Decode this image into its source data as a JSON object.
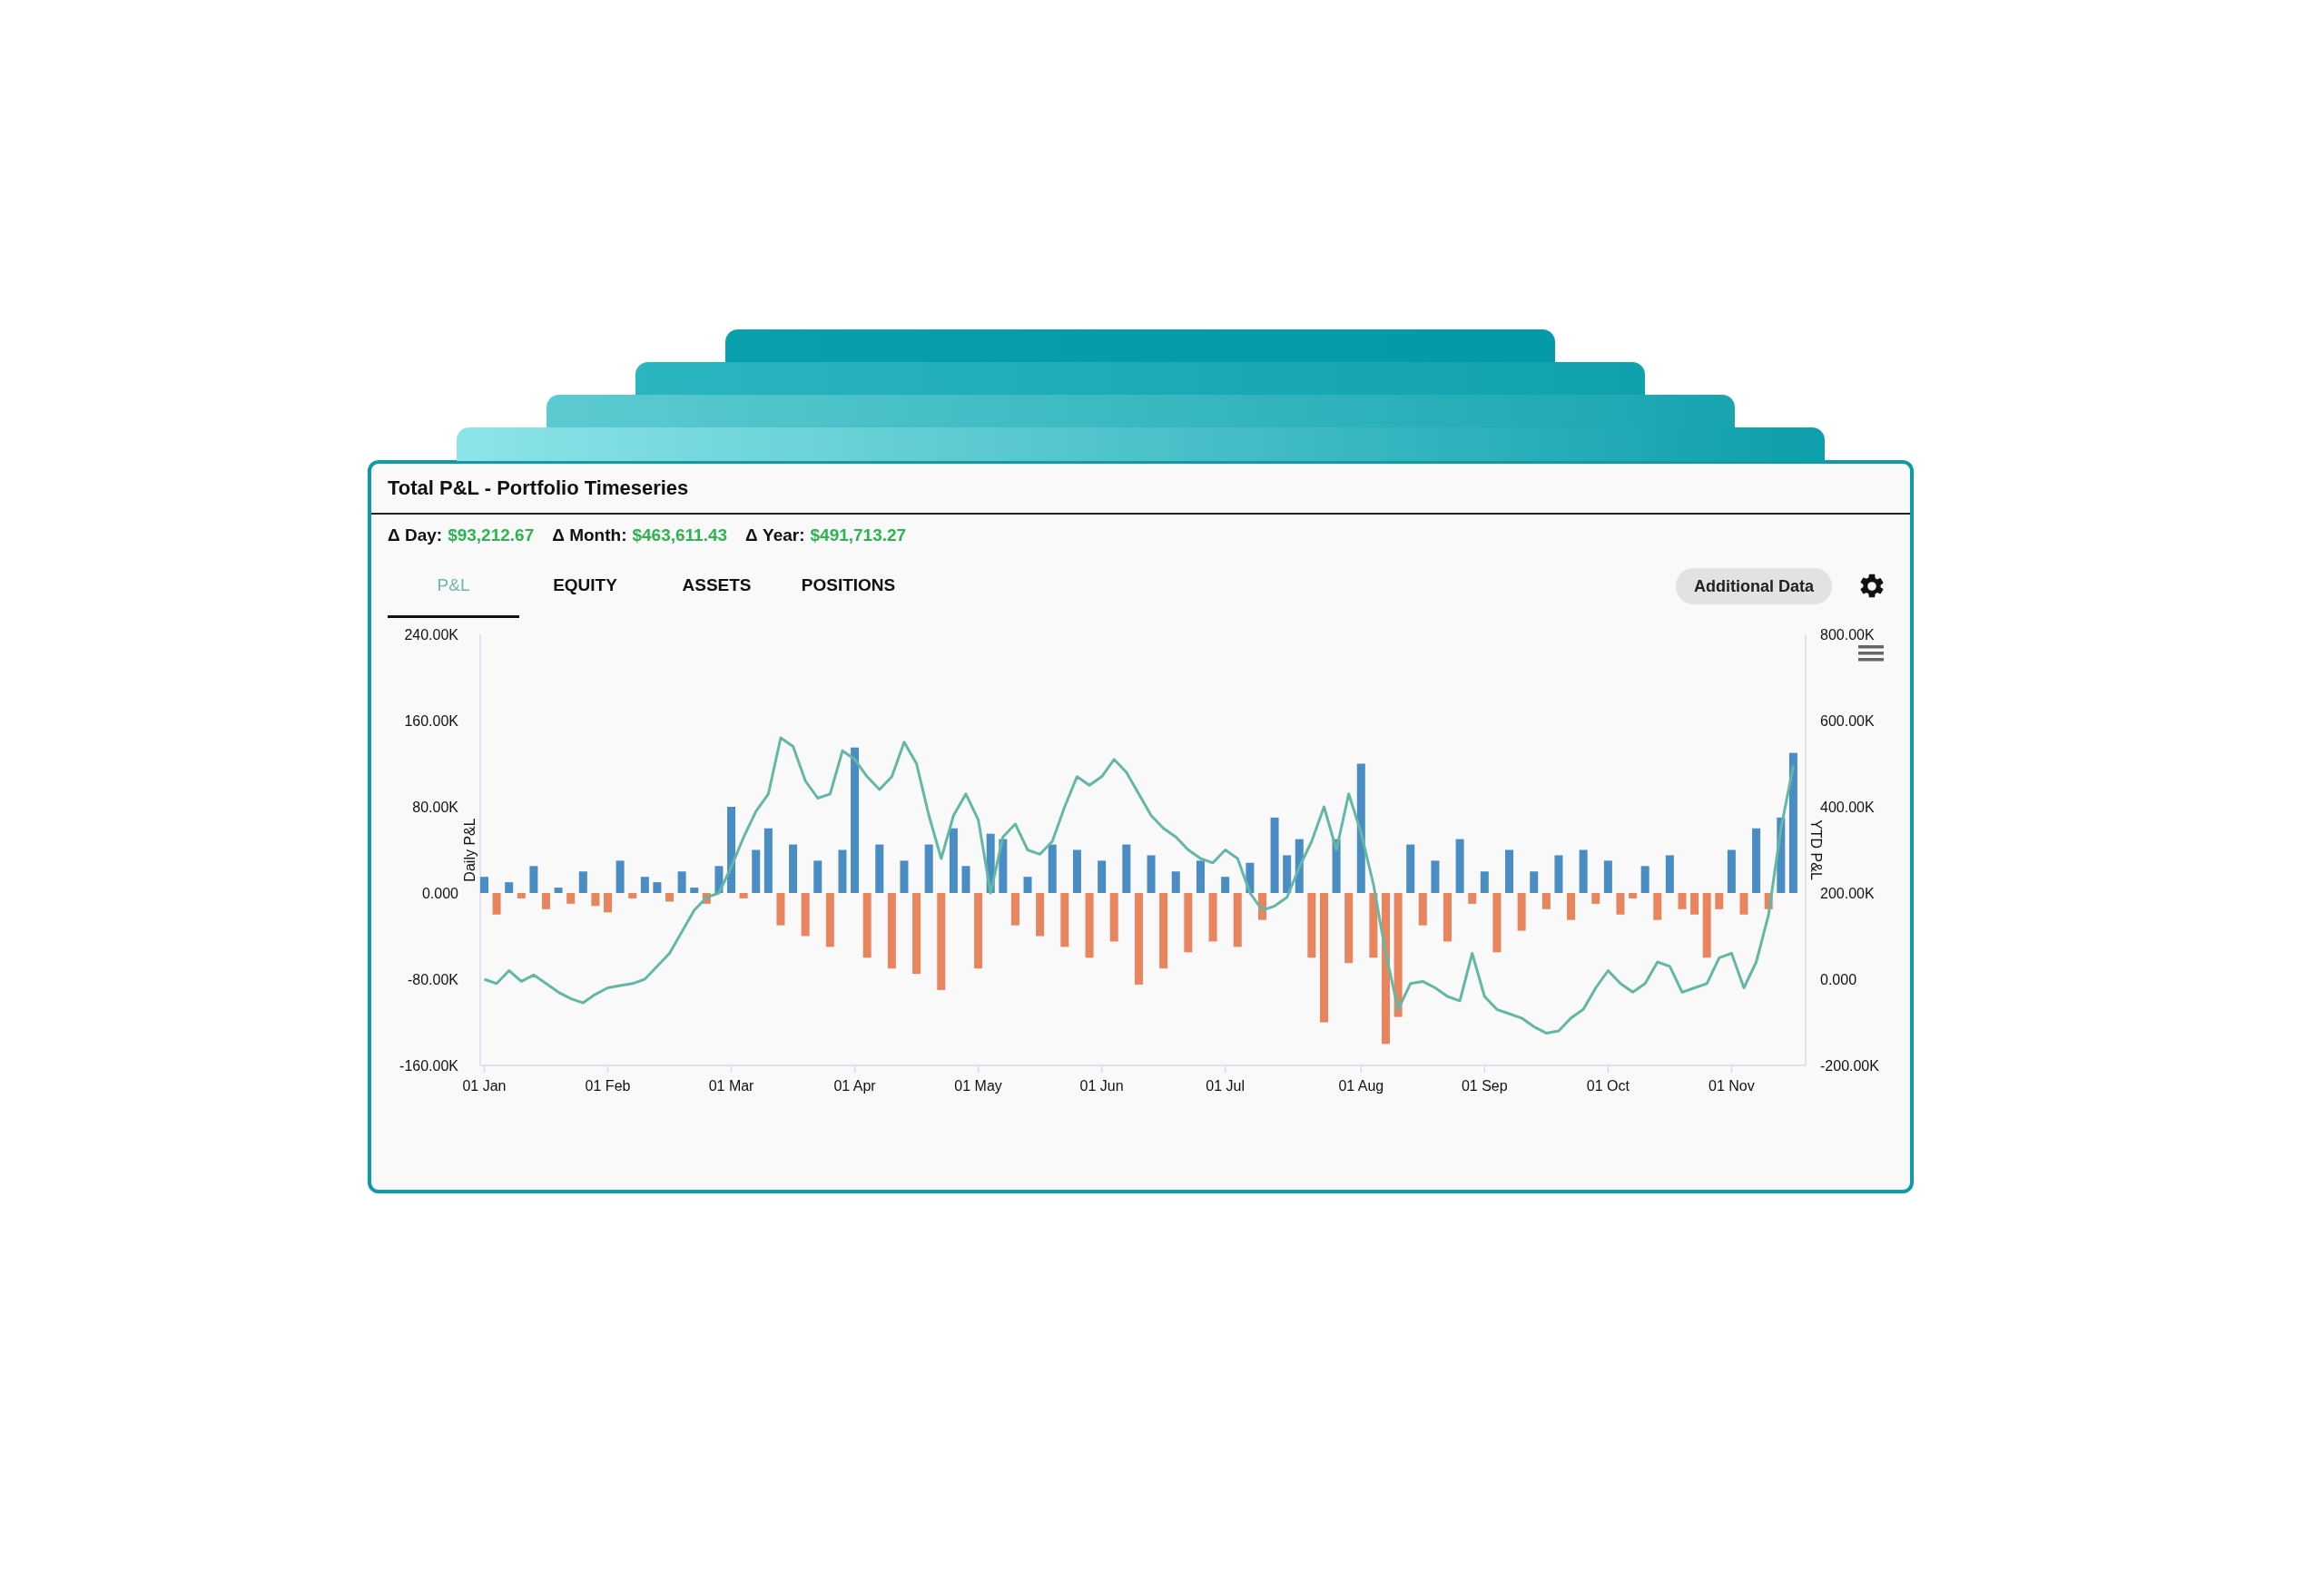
{
  "window": {
    "title": "Total P&L - Portfolio Timeseries"
  },
  "stats": [
    {
      "label": "Δ Day:",
      "value": "$93,212.67"
    },
    {
      "label": "Δ Month:",
      "value": "$463,611.43"
    },
    {
      "label": "Δ Year:",
      "value": "$491,713.27"
    }
  ],
  "tabs": [
    {
      "label": "P&L",
      "selected": true
    },
    {
      "label": "EQUITY",
      "selected": false
    },
    {
      "label": "ASSETS",
      "selected": false
    },
    {
      "label": "POSITIONS",
      "selected": false
    }
  ],
  "additional_button": {
    "label": "Additional Data"
  },
  "chart": {
    "chart_data": {
      "type": "bar",
      "ylabel": "Daily P&L",
      "y2label": "YTD P&L",
      "ylim": [
        -160,
        240
      ],
      "y2lim": [
        -200,
        800
      ],
      "categories": [
        "01 Jan",
        null,
        null,
        null,
        null,
        null,
        null,
        null,
        null,
        null,
        "01 Feb",
        null,
        null,
        null,
        null,
        null,
        null,
        null,
        null,
        null,
        "01 Mar",
        null,
        null,
        null,
        null,
        null,
        null,
        null,
        null,
        null,
        "01 Apr",
        null,
        null,
        null,
        null,
        null,
        null,
        null,
        null,
        null,
        "01 May",
        null,
        null,
        null,
        null,
        null,
        null,
        null,
        null,
        null,
        "01 Jun",
        null,
        null,
        null,
        null,
        null,
        null,
        null,
        null,
        null,
        "01 Jul",
        null,
        null,
        null,
        null,
        null,
        null,
        null,
        null,
        null,
        null,
        "01 Aug",
        null,
        null,
        null,
        null,
        null,
        null,
        null,
        null,
        null,
        "01 Sep",
        null,
        null,
        null,
        null,
        null,
        null,
        null,
        null,
        null,
        "01 Oct",
        null,
        null,
        null,
        null,
        null,
        null,
        null,
        null,
        null,
        "01 Nov",
        null,
        null,
        null,
        null,
        null
      ],
      "yticks": [
        {
          "value": 240,
          "label": "240.00K"
        },
        {
          "value": 160,
          "label": "160.00K"
        },
        {
          "value": 80,
          "label": "80.00K"
        },
        {
          "value": 0,
          "label": "0.000"
        },
        {
          "value": -80,
          "label": "-80.00K"
        },
        {
          "value": -160,
          "label": "-160.00K"
        }
      ],
      "y2ticks": [
        {
          "value": 800,
          "label": "800.00K"
        },
        {
          "value": 600,
          "label": "600.00K"
        },
        {
          "value": 400,
          "label": "400.00K"
        },
        {
          "value": 200,
          "label": "200.00K"
        },
        {
          "value": 0,
          "label": "0.000"
        },
        {
          "value": -200,
          "label": "-200.00K"
        }
      ],
      "series": [
        {
          "color": "#4a8cc4",
          "values": [
            15,
            null,
            10,
            null,
            25,
            null,
            5,
            null,
            20,
            null,
            null,
            30,
            null,
            15,
            10,
            null,
            20,
            5,
            null,
            25,
            80,
            null,
            40,
            60,
            null,
            45,
            null,
            30,
            null,
            40,
            135,
            null,
            45,
            null,
            30,
            null,
            45,
            null,
            60,
            25,
            null,
            55,
            50,
            null,
            15,
            null,
            45,
            null,
            40,
            null,
            30,
            null,
            45,
            null,
            35,
            null,
            20,
            null,
            30,
            null,
            15,
            null,
            28,
            null,
            70,
            35,
            50,
            null,
            null,
            50,
            null,
            120,
            null,
            null,
            null,
            45,
            null,
            30,
            null,
            50,
            null,
            20,
            null,
            40,
            null,
            20,
            null,
            35,
            null,
            40,
            null,
            30,
            null,
            null,
            25,
            null,
            35,
            null,
            null,
            null,
            null,
            40,
            null,
            60,
            null,
            70,
            130
          ]
        },
        {
          "color": "#e8845e",
          "values": [
            null,
            -20,
            null,
            -5,
            null,
            -15,
            null,
            -10,
            null,
            -12,
            -18,
            null,
            -5,
            null,
            null,
            -8,
            null,
            null,
            -10,
            null,
            null,
            -5,
            null,
            null,
            -30,
            null,
            -40,
            null,
            -50,
            null,
            null,
            -60,
            null,
            -70,
            null,
            -75,
            null,
            -90,
            null,
            null,
            -70,
            null,
            null,
            -30,
            null,
            -40,
            null,
            -50,
            null,
            -60,
            null,
            -45,
            null,
            -85,
            null,
            -70,
            null,
            -55,
            null,
            -45,
            null,
            -50,
            null,
            -25,
            null,
            null,
            null,
            -60,
            -120,
            null,
            -65,
            null,
            -60,
            -140,
            -115,
            null,
            -30,
            null,
            -45,
            null,
            -10,
            null,
            -55,
            null,
            -35,
            null,
            -15,
            null,
            -25,
            null,
            -10,
            null,
            -20,
            -5,
            null,
            -25,
            null,
            -15,
            -20,
            -60,
            -15,
            null,
            -20,
            null,
            -15,
            null,
            null
          ]
        },
        {
          "type": "line",
          "axis": "y2",
          "color": "#63b8a5",
          "values": [
            0,
            -10,
            20,
            -5,
            10,
            -10,
            -30,
            -45,
            -55,
            -35,
            -20,
            -15,
            -10,
            0,
            30,
            60,
            110,
            160,
            190,
            200,
            260,
            330,
            390,
            430,
            560,
            540,
            460,
            420,
            430,
            530,
            510,
            470,
            440,
            470,
            550,
            500,
            380,
            280,
            380,
            430,
            370,
            200,
            330,
            360,
            300,
            290,
            320,
            400,
            470,
            450,
            470,
            510,
            480,
            430,
            380,
            350,
            330,
            300,
            280,
            270,
            300,
            280,
            200,
            160,
            170,
            190,
            260,
            320,
            400,
            300,
            430,
            340,
            220,
            60,
            -70,
            -10,
            -5,
            -20,
            -40,
            -50,
            60,
            -40,
            -70,
            -80,
            -90,
            -110,
            -125,
            -120,
            -90,
            -70,
            -20,
            20,
            -10,
            -30,
            -10,
            40,
            30,
            -30,
            -20,
            -10,
            50,
            60,
            -20,
            40,
            150,
            350,
            494
          ]
        }
      ]
    }
  }
}
